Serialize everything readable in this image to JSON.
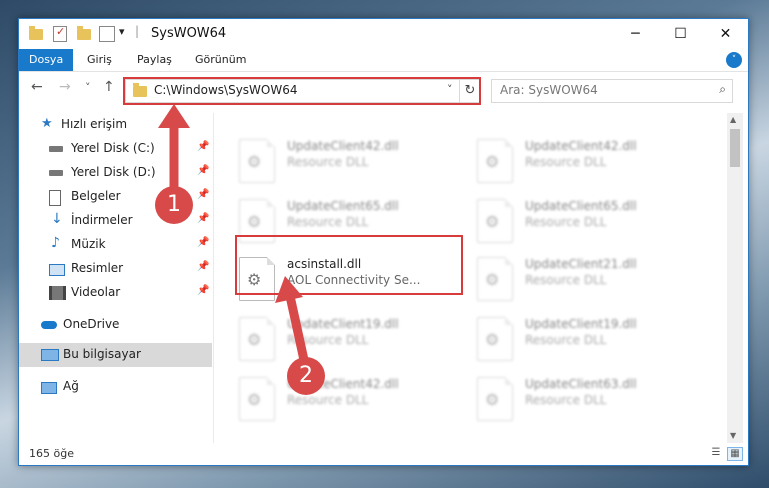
{
  "window": {
    "title": "SysWOW64",
    "minimize_glyph": "─",
    "maximize_glyph": "☐",
    "close_glyph": "✕",
    "qa_dropdown_glyph": "▾"
  },
  "ribbon": {
    "tabs": [
      {
        "label": "Dosya",
        "active": true
      },
      {
        "label": "Giriş"
      },
      {
        "label": "Paylaş"
      },
      {
        "label": "Görünüm"
      }
    ],
    "expand_glyph": "˅"
  },
  "nav": {
    "back_glyph": "←",
    "forward_glyph": "→",
    "recent_glyph": "˅",
    "up_glyph": "↑",
    "address": "C:\\Windows\\SysWOW64",
    "address_dropdown_glyph": "˅",
    "refresh_glyph": "↻",
    "search_placeholder": "Ara: SysWOW64",
    "search_glyph": "⌕"
  },
  "sidebar": {
    "items": [
      {
        "label": "Hızlı erişim",
        "icon": "star-icon"
      },
      {
        "label": "Yerel Disk (C:)",
        "icon": "drive-icon",
        "pinned": true
      },
      {
        "label": "Yerel Disk (D:)",
        "icon": "drive-icon",
        "pinned": true
      },
      {
        "label": "Belgeler",
        "icon": "document-icon",
        "pinned": true
      },
      {
        "label": "İndirmeler",
        "icon": "download-icon",
        "pinned": true
      },
      {
        "label": "Müzik",
        "icon": "music-icon",
        "pinned": true
      },
      {
        "label": "Resimler",
        "icon": "pictures-icon",
        "pinned": true
      },
      {
        "label": "Videolar",
        "icon": "video-icon",
        "pinned": true
      },
      {
        "label": "OneDrive",
        "icon": "cloud-icon"
      },
      {
        "label": "Bu bilgisayar",
        "icon": "computer-icon",
        "selected": true
      },
      {
        "label": "Ağ",
        "icon": "network-icon"
      }
    ],
    "pin_glyph": "📌"
  },
  "files": [
    {
      "name": "UpdateClient42.dll",
      "desc": "Resource DLL"
    },
    {
      "name": "UpdateClient42.dll",
      "desc": "Resource DLL"
    },
    {
      "name": "UpdateClient65.dll",
      "desc": "Resource DLL"
    },
    {
      "name": "UpdateClient65.dll",
      "desc": "Resource DLL"
    },
    {
      "name": "acsinstall.dll",
      "desc": "AOL Connectivity Se...",
      "focus": true
    },
    {
      "name": "UpdateClient21.dll",
      "desc": "Resource DLL"
    },
    {
      "name": "UpdateClient19.dll",
      "desc": "Resource DLL"
    },
    {
      "name": "UpdateClient19.dll",
      "desc": "Resource DLL"
    },
    {
      "name": "UpdateClient42.dll",
      "desc": "Resource DLL"
    },
    {
      "name": "UpdateClient63.dll",
      "desc": "Resource DLL"
    }
  ],
  "scroll": {
    "up_glyph": "▲",
    "down_glyph": "▼"
  },
  "status": {
    "count": "165 öğe",
    "details_glyph": "☰",
    "tiles_glyph": "▦"
  },
  "annotations": {
    "step1": "1",
    "step2": "2",
    "color": "#d83b3b"
  }
}
